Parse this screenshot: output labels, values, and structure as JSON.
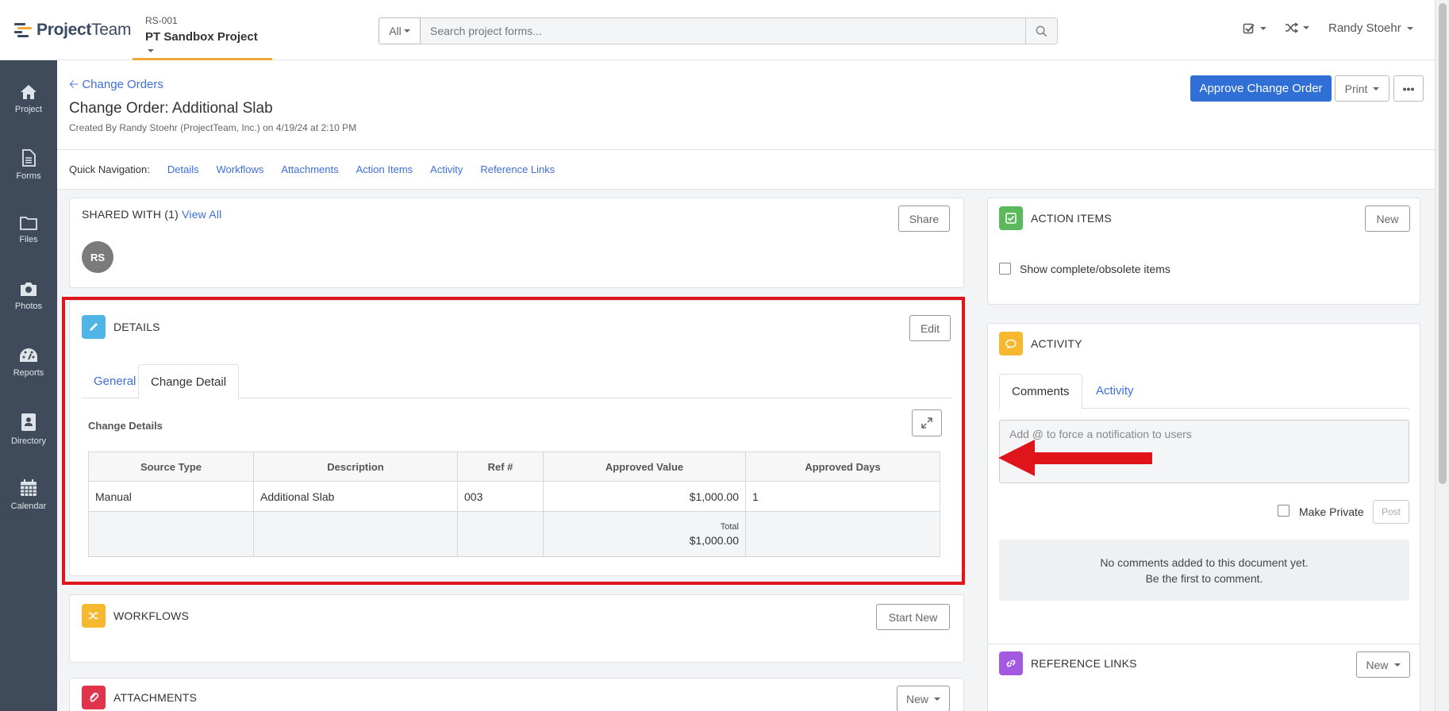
{
  "app": {
    "logo_text_bold": "Project",
    "logo_text_light": "Team"
  },
  "project": {
    "code": "RS-001",
    "name": "PT Sandbox Project"
  },
  "search": {
    "scope": "All",
    "placeholder": "Search project forms..."
  },
  "user": {
    "name": "Randy Stoehr"
  },
  "sidebar": {
    "items": [
      {
        "label": "Project",
        "icon": "home-icon"
      },
      {
        "label": "Forms",
        "icon": "document-icon"
      },
      {
        "label": "Files",
        "icon": "folder-icon"
      },
      {
        "label": "Photos",
        "icon": "camera-icon"
      },
      {
        "label": "Reports",
        "icon": "dashboard-icon"
      },
      {
        "label": "Directory",
        "icon": "contact-book-icon"
      },
      {
        "label": "Calendar",
        "icon": "calendar-icon"
      }
    ]
  },
  "header": {
    "back_link": "Change Orders",
    "title": "Change Order: Additional Slab",
    "created": "Created By Randy Stoehr (ProjectTeam, Inc.) on 4/19/24 at 2:10 PM",
    "approve_label": "Approve Change Order",
    "print_label": "Print",
    "more_label": "•••"
  },
  "quick_nav": {
    "label": "Quick Navigation:",
    "links": [
      "Details",
      "Workflows",
      "Attachments",
      "Action Items",
      "Activity",
      "Reference Links"
    ]
  },
  "shared": {
    "title": "SHARED WITH (1)",
    "view_all": "View All",
    "share_label": "Share",
    "avatar_initials": "RS"
  },
  "details": {
    "title": "DETAILS",
    "edit_label": "Edit",
    "tabs": [
      "General",
      "Change Detail"
    ],
    "active_tab": "Change Detail",
    "section_title": "Change Details",
    "columns": [
      "Source Type",
      "Description",
      "Ref #",
      "Approved Value",
      "Approved Days"
    ],
    "rows": [
      [
        "Manual",
        "Additional Slab",
        "003",
        "$1,000.00",
        "1"
      ]
    ],
    "total_label": "Total",
    "total_value": "$1,000.00"
  },
  "workflows": {
    "title": "WORKFLOWS",
    "start_label": "Start New"
  },
  "attachments": {
    "title": "ATTACHMENTS",
    "new_label": "New"
  },
  "action_items": {
    "title": "ACTION ITEMS",
    "new_label": "New",
    "show_label": "Show complete/obsolete items"
  },
  "activity": {
    "title": "ACTIVITY",
    "tabs": [
      "Comments",
      "Activity"
    ],
    "active_tab": "Comments",
    "comment_placeholder": "Add @ to force a notification to users",
    "private_label": "Make Private",
    "post_label": "Post",
    "empty_line1": "No comments added to this document yet.",
    "empty_line2": "Be the first to comment."
  },
  "reference_links": {
    "title": "REFERENCE LINKS",
    "new_label": "New"
  },
  "colors": {
    "sidebar": "#3f4b5b",
    "accent": "#3e6fd8",
    "approve": "#2f6fd6",
    "details_icon": "#4fb4e6",
    "workflows_icon": "#f5b82e",
    "attachments_icon": "#e0334c",
    "action_icon": "#5cb85c",
    "activity_icon": "#f5b82e",
    "reference_icon": "#a35ae0",
    "highlight": "#e0151b",
    "arrow": "#e0151b"
  }
}
